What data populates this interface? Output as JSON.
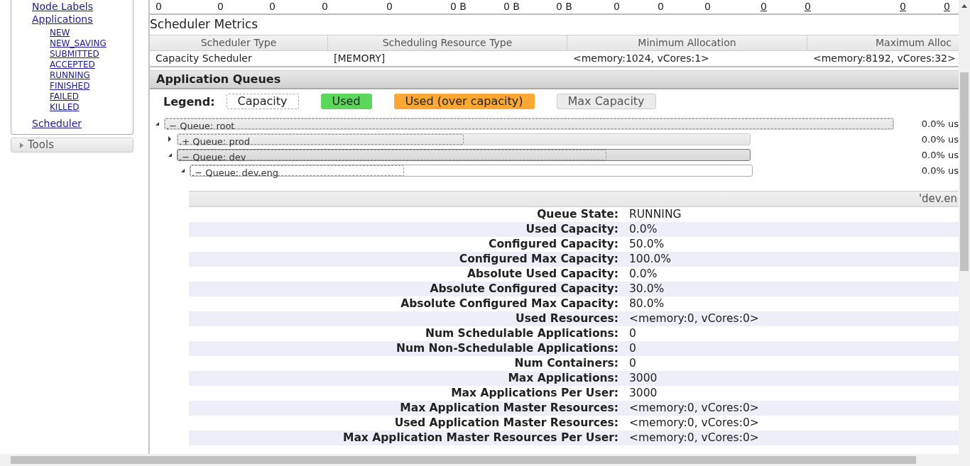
{
  "sidebar": {
    "items": [
      {
        "label": "Node Labels"
      },
      {
        "label": "Applications",
        "children": [
          {
            "label": "NEW"
          },
          {
            "label": "NEW_SAVING"
          },
          {
            "label": "SUBMITTED"
          },
          {
            "label": "ACCEPTED"
          },
          {
            "label": "RUNNING"
          },
          {
            "label": "FINISHED"
          },
          {
            "label": "FAILED"
          },
          {
            "label": "KILLED"
          }
        ]
      },
      {
        "label": "Scheduler"
      }
    ],
    "tools": {
      "label": "Tools",
      "expanded": false
    }
  },
  "cluster_metrics_row": [
    {
      "text": "0",
      "link": false
    },
    {
      "text": "0",
      "link": false
    },
    {
      "text": "0",
      "link": false
    },
    {
      "text": "0",
      "link": false
    },
    {
      "text": "0",
      "link": false
    },
    {
      "text": "0 B",
      "link": false
    },
    {
      "text": "0 B",
      "link": false
    },
    {
      "text": "0 B",
      "link": false
    },
    {
      "text": "0",
      "link": false
    },
    {
      "text": "0",
      "link": false
    },
    {
      "text": "0",
      "link": false
    },
    {
      "text": "0",
      "link": true
    },
    {
      "text": "0",
      "link": true
    },
    {
      "text": "0",
      "link": true
    },
    {
      "text": "0",
      "link": true
    }
  ],
  "scheduler_metrics": {
    "title": "Scheduler Metrics",
    "columns": [
      "Scheduler Type",
      "Scheduling Resource Type",
      "Minimum Allocation",
      "Maximum Alloc"
    ],
    "rows": [
      [
        "Capacity Scheduler",
        "[MEMORY]",
        "<memory:1024, vCores:1>",
        "<memory:8192, vCores:32>"
      ]
    ]
  },
  "application_queues": {
    "title": "Application Queues",
    "legend_label": "Legend:",
    "legend": [
      {
        "label": "Capacity",
        "kind": "dashed",
        "color": "#ffffff"
      },
      {
        "label": "Used",
        "kind": "solid",
        "color": "#5bd75b"
      },
      {
        "label": "Used (over capacity)",
        "kind": "solid",
        "color": "#ffa733"
      },
      {
        "label": "Max Capacity",
        "kind": "outline",
        "color": "#ebebeb"
      }
    ],
    "queues": [
      {
        "name": "Queue: root",
        "sign": ".−",
        "expanded": true,
        "selected": false,
        "hovered": false,
        "level": 1,
        "used": "0.0% us",
        "children": [
          {
            "name": "Queue: prod",
            "sign": ".+",
            "expanded": false,
            "selected": false,
            "hovered": false,
            "level": 0.5,
            "used": "0.0% us"
          },
          {
            "name": "Queue: dev",
            "sign": ".−",
            "expanded": true,
            "selected": false,
            "hovered": true,
            "level": 0.75,
            "used": "0.0% us",
            "children": [
              {
                "name": "Queue: dev.eng",
                "sign": ".−",
                "expanded": true,
                "selected": true,
                "hovered": false,
                "level": 0.38,
                "used": "0.0% us"
              }
            ]
          }
        ]
      }
    ],
    "details": {
      "title": "'dev.en",
      "rows": [
        {
          "label": "Queue State:",
          "value": "RUNNING"
        },
        {
          "label": "Used Capacity:",
          "value": "0.0%"
        },
        {
          "label": "Configured Capacity:",
          "value": "50.0%"
        },
        {
          "label": "Configured Max Capacity:",
          "value": "100.0%"
        },
        {
          "label": "Absolute Used Capacity:",
          "value": "0.0%"
        },
        {
          "label": "Absolute Configured Capacity:",
          "value": "30.0%"
        },
        {
          "label": "Absolute Configured Max Capacity:",
          "value": "80.0%"
        },
        {
          "label": "Used Resources:",
          "value": "<memory:0, vCores:0>"
        },
        {
          "label": "Num Schedulable Applications:",
          "value": "0"
        },
        {
          "label": "Num Non-Schedulable Applications:",
          "value": "0"
        },
        {
          "label": "Num Containers:",
          "value": "0"
        },
        {
          "label": "Max Applications:",
          "value": "3000"
        },
        {
          "label": "Max Applications Per User:",
          "value": "3000"
        },
        {
          "label": "Max Application Master Resources:",
          "value": "<memory:0, vCores:0>"
        },
        {
          "label": "Used Application Master Resources:",
          "value": "<memory:0, vCores:0>"
        },
        {
          "label": "Max Application Master Resources Per User:",
          "value": "<memory:0, vCores:0>"
        }
      ]
    }
  }
}
